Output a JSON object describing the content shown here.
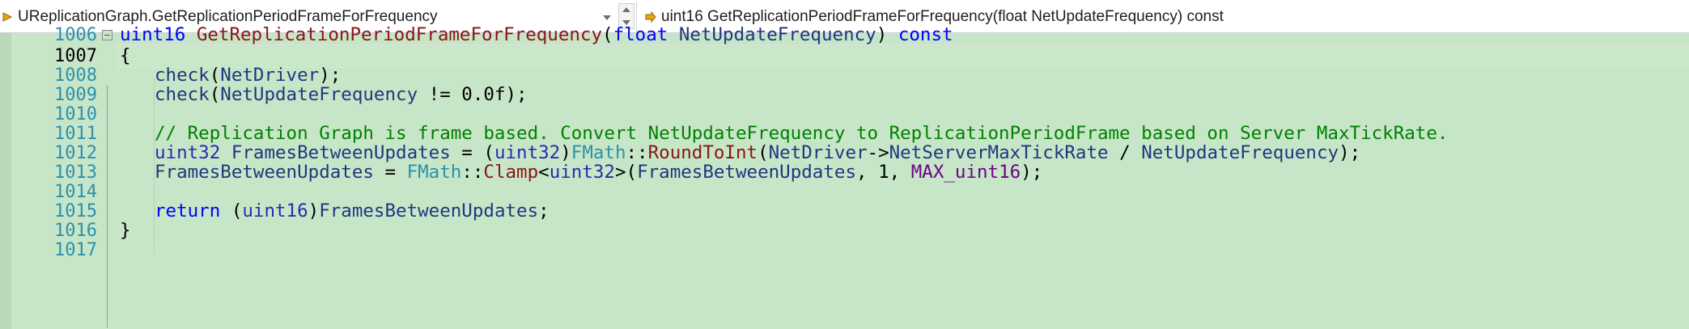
{
  "navbar": {
    "scope_combo": "UReplicationGraph.GetReplicationPeriodFrameForFrequency",
    "member_combo": "uint16 GetReplicationPeriodFrameForFrequency(float NetUpdateFrequency) const"
  },
  "editor": {
    "current_line": "1007",
    "lines": [
      {
        "num": "1006",
        "tokens": [
          "uint16",
          " ",
          "GetReplicationPeriodFrameForFrequency",
          "(",
          "float",
          " ",
          "NetUpdateFrequency",
          ") ",
          "const"
        ]
      },
      {
        "num": "1007",
        "tokens": [
          "{"
        ]
      },
      {
        "num": "1008",
        "tokens": [
          "check",
          "(",
          "NetDriver",
          ");"
        ]
      },
      {
        "num": "1009",
        "tokens": [
          "check",
          "(",
          "NetUpdateFrequency",
          " != 0.0f);"
        ]
      },
      {
        "num": "1010",
        "tokens": []
      },
      {
        "num": "1011",
        "tokens": [
          "// Replication Graph is frame based. Convert NetUpdateFrequency to ReplicationPeriodFrame based on Server MaxTickRate."
        ]
      },
      {
        "num": "1012",
        "tokens": [
          "uint32",
          " ",
          "FramesBetweenUpdates",
          " = (",
          "uint32",
          ")",
          "FMath",
          "::",
          "RoundToInt",
          "(",
          "NetDriver",
          "->",
          "NetServerMaxTickRate",
          " / ",
          "NetUpdateFrequency",
          ");"
        ]
      },
      {
        "num": "1013",
        "tokens": [
          "FramesBetweenUpdates",
          " = ",
          "FMath",
          "::",
          "Clamp",
          "<",
          "uint32",
          ">(",
          "FramesBetweenUpdates",
          ", 1, ",
          "MAX_uint16",
          ");"
        ]
      },
      {
        "num": "1014",
        "tokens": []
      },
      {
        "num": "1015",
        "tokens": [
          "return",
          " (",
          "uint16",
          ")",
          "FramesBetweenUpdates",
          ";"
        ]
      },
      {
        "num": "1016",
        "tokens": [
          "}"
        ]
      },
      {
        "num": "1017",
        "tokens": []
      }
    ]
  }
}
